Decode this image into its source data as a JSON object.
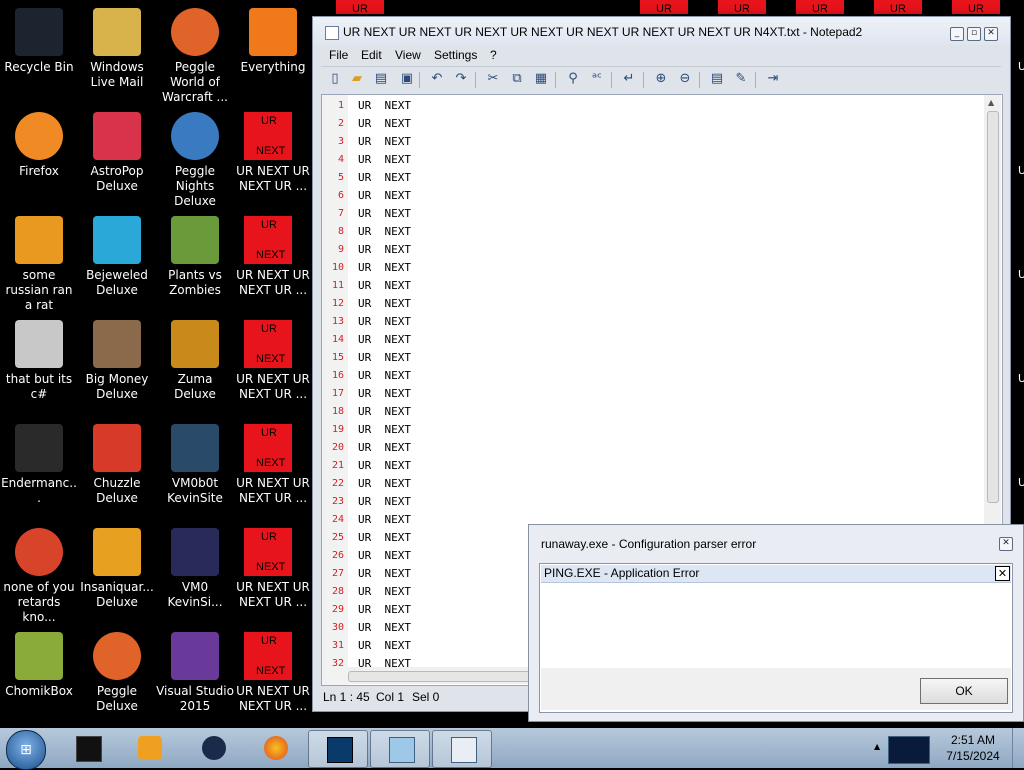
{
  "desktop": {
    "icons": [
      {
        "label": "Recycle Bin",
        "icon": "recycle-bin-icon",
        "color": "#1d2430"
      },
      {
        "label": "Windows Live Mail",
        "icon": "mail-icon",
        "color": "#d8b24a"
      },
      {
        "label": "Peggle World of Warcraft ...",
        "icon": "peggle-icon",
        "color": "#e0632a"
      },
      {
        "label": "Everything",
        "icon": "everything-icon",
        "color": "#f07a1a"
      },
      {
        "label": "Firefox",
        "icon": "firefox-icon",
        "color": "#f08a24"
      },
      {
        "label": "AstroPop Deluxe",
        "icon": "astropop-icon",
        "color": "#d8334a"
      },
      {
        "label": "Peggle Nights Deluxe",
        "icon": "peggle-nights-icon",
        "color": "#3a7ac0"
      },
      {
        "label": "UR NEXT UR NEXT UR ...",
        "icon": "ur-next-icon",
        "color": "#e8141b"
      },
      {
        "label": "some russian ran a rat",
        "icon": "generic-exe-icon",
        "color": "#e89a20"
      },
      {
        "label": "Bejeweled Deluxe",
        "icon": "bejeweled-icon",
        "color": "#2aa8d8"
      },
      {
        "label": "Plants vs Zombies",
        "icon": "plants-vs-zombies-icon",
        "color": "#6a9a3a"
      },
      {
        "label": "UR NEXT UR NEXT UR ...",
        "icon": "ur-next-icon",
        "color": "#e8141b"
      },
      {
        "label": "that but its c#",
        "icon": "shortcut-icon",
        "color": "#c8c8c8"
      },
      {
        "label": "Big Money Deluxe",
        "icon": "big-money-icon",
        "color": "#8a6a4a"
      },
      {
        "label": "Zuma Deluxe",
        "icon": "zuma-icon",
        "color": "#c88a1a"
      },
      {
        "label": "UR NEXT UR NEXT UR ...",
        "icon": "ur-next-icon",
        "color": "#e8141b"
      },
      {
        "label": "Endermanc...",
        "icon": "terminal-icon",
        "color": "#2a2a2a"
      },
      {
        "label": "Chuzzle Deluxe",
        "icon": "chuzzle-icon",
        "color": "#d83a2a"
      },
      {
        "label": "VM0b0t KevinSite",
        "icon": "vm-icon",
        "color": "#2a4a6a"
      },
      {
        "label": "UR NEXT UR NEXT UR ...",
        "icon": "ur-next-icon",
        "color": "#e8141b"
      },
      {
        "label": "none of you retards kno...",
        "icon": "chrome-icon",
        "color": "#d8442a"
      },
      {
        "label": "Insaniquar... Deluxe",
        "icon": "insaniquarium-icon",
        "color": "#e8a020"
      },
      {
        "label": "VM0 KevinSi...",
        "icon": "vm-icon",
        "color": "#2a2a5a"
      },
      {
        "label": "UR NEXT UR NEXT UR ...",
        "icon": "ur-next-icon",
        "color": "#e8141b"
      },
      {
        "label": "ChomikBox",
        "icon": "chomikbox-icon",
        "color": "#8aaa3a"
      },
      {
        "label": "Peggle Deluxe",
        "icon": "peggle-deluxe-icon",
        "color": "#e0632a"
      },
      {
        "label": "Visual Studio 2015",
        "icon": "visual-studio-icon",
        "color": "#6a3a9a"
      },
      {
        "label": "UR NEXT UR NEXT UR ...",
        "icon": "ur-next-icon",
        "color": "#e8141b"
      }
    ],
    "tile_top": "UR",
    "tile_bottom": "NEXT",
    "peek_label": "UR",
    "right_edge_letter": "U"
  },
  "notepad": {
    "title": "UR NEXT UR NEXT UR NEXT UR NEXT UR NEXT UR NEXT UR NEXT UR N4XT.txt - Notepad2",
    "menu": [
      "File",
      "Edit",
      "View",
      "Settings",
      "?"
    ],
    "line_text": "UR  NEXT",
    "line_numbers": [
      "1",
      "2",
      "3",
      "4",
      "5",
      "6",
      "7",
      "8",
      "9",
      "10",
      "11",
      "12",
      "13",
      "14",
      "15",
      "16",
      "17",
      "18",
      "19",
      "20",
      "21",
      "22",
      "23",
      "24",
      "25",
      "26",
      "27",
      "28",
      "29",
      "30",
      "31",
      "32"
    ],
    "status": {
      "ln": "Ln 1 : 45",
      "col": "Col 1",
      "sel": "Sel 0"
    }
  },
  "dialog": {
    "title": "runaway.exe - Configuration parser error",
    "inner_title": "PING.EXE - Application Error",
    "ok_label": "OK"
  },
  "taskbar": {
    "time": "2:51 AM",
    "date": "7/15/2024"
  },
  "colors": {
    "ur_red": "#e8141b",
    "line_number_red": "#d22020",
    "taskbar": "#a9bfd6"
  }
}
